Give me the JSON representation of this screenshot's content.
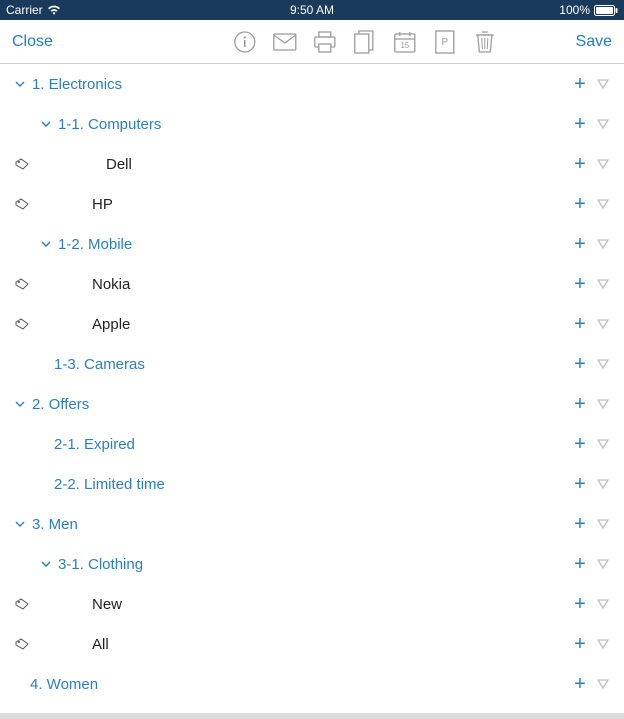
{
  "status": {
    "carrier": "Carrier",
    "time": "9:50 AM",
    "battery": "100%"
  },
  "toolbar": {
    "close": "Close",
    "save": "Save"
  },
  "rows": [
    {
      "label": "1. Electronics",
      "level": 0,
      "type": "category",
      "expanded": true
    },
    {
      "label": "1-1. Computers",
      "level": 1,
      "type": "subcategory",
      "expanded": true
    },
    {
      "label": "Dell",
      "level": 2,
      "type": "item"
    },
    {
      "label": "HP",
      "level": 2,
      "type": "item"
    },
    {
      "label": "1-2. Mobile",
      "level": 1,
      "type": "subcategory",
      "expanded": true
    },
    {
      "label": "Nokia",
      "level": 2,
      "type": "item"
    },
    {
      "label": "Apple",
      "level": 2,
      "type": "item"
    },
    {
      "label": "1-3. Cameras",
      "level": 1,
      "type": "subcategory",
      "expanded": false
    },
    {
      "label": "2. Offers",
      "level": 0,
      "type": "category",
      "expanded": true
    },
    {
      "label": "2-1. Expired",
      "level": 1,
      "type": "subcategory",
      "expanded": false
    },
    {
      "label": "2-2. Limited time",
      "level": 1,
      "type": "subcategory",
      "expanded": false
    },
    {
      "label": "3. Men",
      "level": 0,
      "type": "category",
      "expanded": true
    },
    {
      "label": "3-1. Clothing",
      "level": 1,
      "type": "subcategory",
      "expanded": true
    },
    {
      "label": "New",
      "level": 2,
      "type": "item"
    },
    {
      "label": "All",
      "level": 2,
      "type": "item"
    },
    {
      "label": "4. Women",
      "level": 0,
      "type": "category",
      "expanded": false,
      "indentExtra": true
    }
  ]
}
